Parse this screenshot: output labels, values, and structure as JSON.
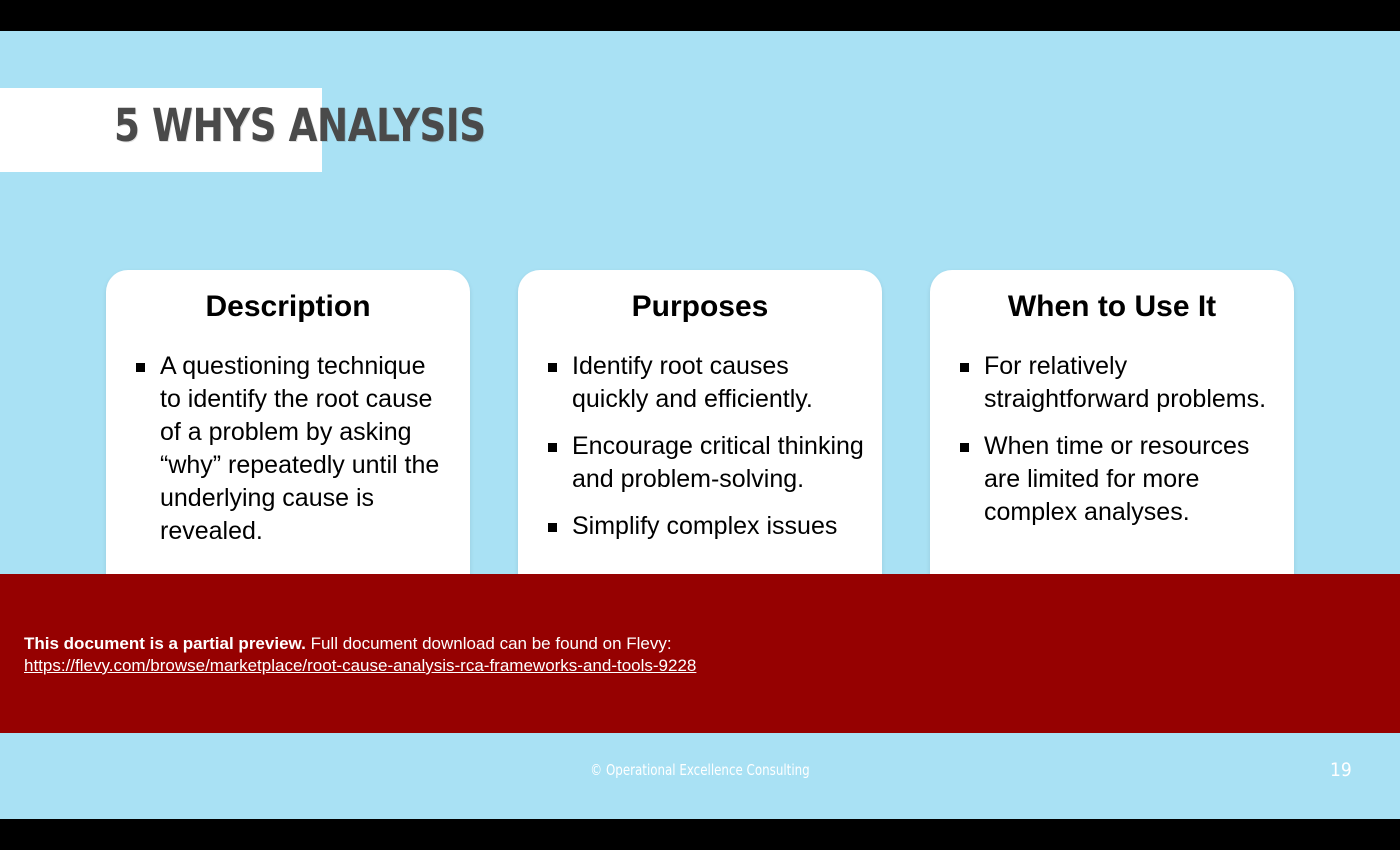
{
  "slide": {
    "title": "5 Whys Analysis",
    "background_color": "#A9E1F4",
    "title_color": "#4A4A4A",
    "page_number": "19"
  },
  "cards": [
    {
      "heading": "Description",
      "bullets": [
        "A questioning technique to identify the root cause of a problem by asking “why” repeatedly until the underlying cause is revealed."
      ]
    },
    {
      "heading": "Purposes",
      "bullets": [
        "Identify root causes quickly and efficiently.",
        "Encourage critical thinking and problem-solving.",
        "Simplify complex issues"
      ]
    },
    {
      "heading": "When to Use It",
      "bullets": [
        "For relatively straightforward problems.",
        "When time or resources are limited for more complex analyses."
      ]
    }
  ],
  "preview_banner": {
    "background_color": "#960101",
    "lead_text": "This document is a partial preview.",
    "body_text": "Full document download can be found on Flevy:",
    "url": "https://flevy.com/browse/marketplace/root-cause-analysis-rca-frameworks-and-tools-9228"
  },
  "footer": {
    "copyright": "© Operational Excellence Consulting",
    "page_number": "19"
  }
}
